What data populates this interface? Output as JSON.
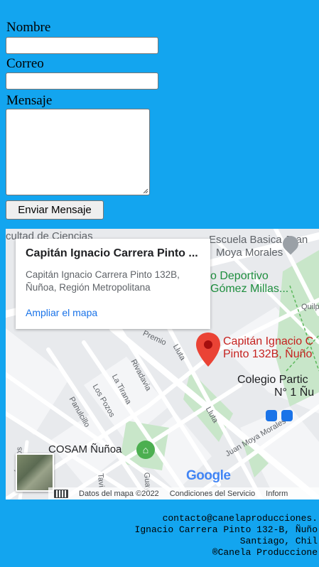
{
  "form": {
    "name_label": "Nombre",
    "email_label": "Correo",
    "message_label": "Mensaje",
    "submit_label": "Enviar Mensaje"
  },
  "map": {
    "card": {
      "title": "Capitán Ignacio Carrera Pinto ...",
      "address_line1": "Capitán Ignacio Carrera Pinto 132B,",
      "address_line2": "Ñuñoa, Región Metropolitana",
      "link": "Ampliar el mapa"
    },
    "pin_label_line1": "Capitán Ignacio C",
    "pin_label_line2": "Pinto 132B, Ñuño",
    "labels": {
      "facultad": "cultad de Ciencias",
      "escuela_line1": "Escuela Basica Juan",
      "escuela_line2": "Moya Morales",
      "centro_line1": "o Deportivo",
      "centro_line2": "Gómez Millas...",
      "colegio_line1": "Colegio Partic",
      "colegio_line2": "N° 1 Ñu",
      "cosam": "COSAM Ñuñoa",
      "quilpue": "Quilp",
      "premio": "Premio",
      "lluta1": "Lluta",
      "lluta2": "Lluta",
      "rivadavia": "Rivadavia",
      "latirana": "La Tirana",
      "lospozos": "Los Pozos",
      "panulcillo": "Panulcillo",
      "juanmoya": "Juan Moya Morales",
      "tavi": "Tavi",
      "guay": "Guay",
      "lapinos": "Ó pinos"
    },
    "logo": "Google",
    "attribution": {
      "data": "Datos del mapa ©2022",
      "terms": "Condiciones del Servicio",
      "report": "Inform"
    }
  },
  "footer": {
    "email": "contacto@canelaproducciones.",
    "address": "Ignacio Carrera Pinto 132-B, Ñuño",
    "city": "Santiago, Chil",
    "copyright": "®Canela Produccione"
  }
}
